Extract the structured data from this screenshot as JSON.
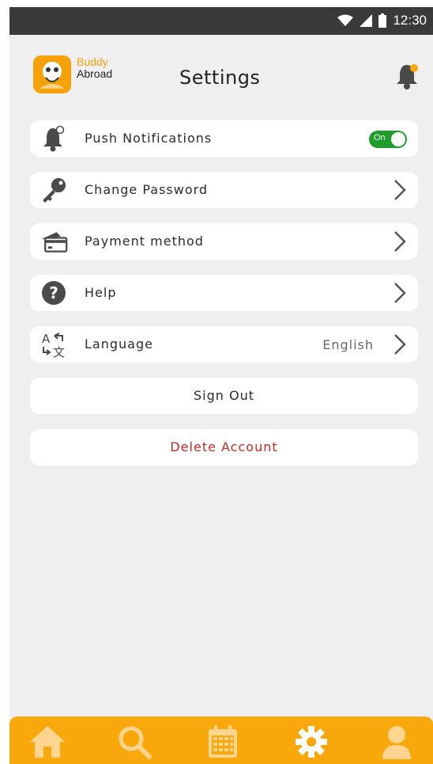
{
  "status_bar": {
    "time": "12:30"
  },
  "header": {
    "brand_line1": "Buddy",
    "brand_line2": "Abroad",
    "title": "Settings"
  },
  "settings": {
    "push": {
      "label": "Push Notifications",
      "toggle_text": "On"
    },
    "password": {
      "label": "Change Password"
    },
    "payment": {
      "label": "Payment method"
    },
    "help": {
      "label": "Help"
    },
    "language": {
      "label": "Language",
      "value": "English"
    }
  },
  "actions": {
    "sign_out": "Sign Out",
    "delete_account": "Delete Account"
  },
  "colors": {
    "accent": "#f9a80c",
    "toggle_on": "#1f9d2b",
    "danger": "#c62828",
    "status_bar": "#3a3a3a"
  },
  "icons": {
    "tabs": [
      "home-icon",
      "search-icon",
      "calendar-icon",
      "gear-icon",
      "user-icon"
    ],
    "header_right": "bell-icon"
  }
}
